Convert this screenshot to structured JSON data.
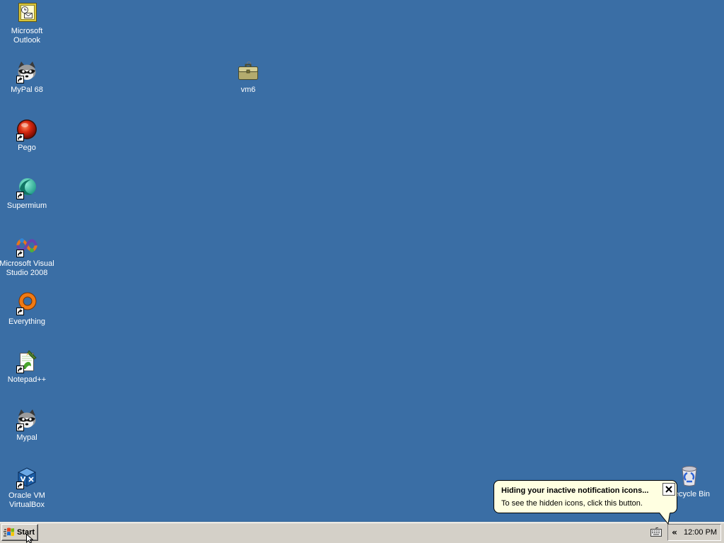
{
  "desktop": {
    "background_color": "#3A6EA5",
    "icons": [
      {
        "label": "Microsoft Outlook",
        "icon": "outlook-icon",
        "shortcut": false
      },
      {
        "label": "MyPal 68",
        "icon": "raccoon-icon",
        "shortcut": true
      },
      {
        "label": "vm6",
        "icon": "briefcase-icon",
        "shortcut": false
      },
      {
        "label": "Pego",
        "icon": "pego-icon",
        "shortcut": true
      },
      {
        "label": "Supermium",
        "icon": "supermium-icon",
        "shortcut": true
      },
      {
        "label": "Microsoft Visual Studio 2008",
        "icon": "visual-studio-icon",
        "shortcut": true
      },
      {
        "label": "Everything",
        "icon": "everything-icon",
        "shortcut": true
      },
      {
        "label": "Notepad++",
        "icon": "notepad-plus-plus-icon",
        "shortcut": true
      },
      {
        "label": "Mypal",
        "icon": "raccoon-icon",
        "shortcut": true
      },
      {
        "label": "Oracle VM VirtualBox",
        "icon": "virtualbox-icon",
        "shortcut": true
      },
      {
        "label": "Recycle Bin",
        "icon": "recycle-bin-icon",
        "shortcut": false
      }
    ]
  },
  "balloon": {
    "title": "Hiding your inactive notification icons...",
    "text": "To see the hidden icons, click this button.",
    "close_icon": "close-icon",
    "background_color": "#FFFFE1"
  },
  "taskbar": {
    "background_color": "#D4D0C8",
    "start_button": {
      "label": "Start",
      "icon": "windows-flag-icon"
    },
    "quick_icons": [
      "keyboard-icon"
    ],
    "tray": {
      "chevron_label": "«",
      "clock": "12:00 PM"
    }
  },
  "cursor": {
    "icon": "arrow-pointer-icon"
  }
}
